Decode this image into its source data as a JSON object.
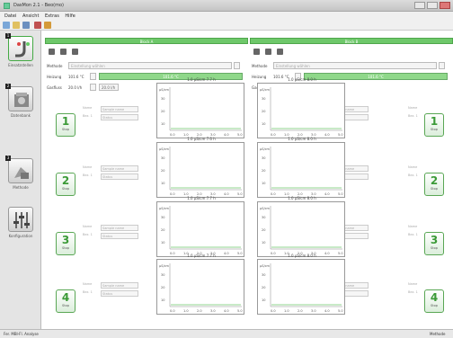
{
  "window": {
    "title": "DasMon 2.1 - Beo(mo)"
  },
  "menu": [
    "Datei",
    "Ansicht",
    "Extras",
    "Hilfe"
  ],
  "sidebar": [
    {
      "label": "Einsatzstellen",
      "num": "1"
    },
    {
      "label": "Datenbank",
      "num": "2"
    },
    {
      "label": "Methode",
      "num": "3"
    },
    {
      "label": "Konfiguration",
      "num": ""
    }
  ],
  "panels": [
    {
      "header": "Block A",
      "methode_label": "Methode",
      "methode_value": "Einstellung wählen",
      "heizung_label": "Heizung",
      "heizung_value": "101.6 °C",
      "heizung_bar": "101.6 °C",
      "heizung_percent": 100,
      "gasfluss_label": "Gasfluss",
      "gasfluss_value": "20.0 l/h",
      "gasfluss_box": "20.0 l/h"
    },
    {
      "header": "Block B",
      "methode_label": "Methode",
      "methode_value": "Einstellung wählen",
      "heizung_label": "Heizung",
      "heizung_value": "101.6 °C",
      "heizung_bar": "101.6 °C",
      "heizung_percent": 100,
      "gasfluss_label": "Gasfluss",
      "gasfluss_value": "20.0 l/h",
      "gasfluss_box": "20.0 l/h"
    }
  ],
  "channels": [
    {
      "num": "1",
      "stop": "Stop",
      "charts": [
        "1.0 µS/cm  7.7 h",
        "1.0 µS/cm  8.0 h"
      ]
    },
    {
      "num": "2",
      "stop": "Stop",
      "charts": [
        "1.0 µS/cm  7.6 h",
        "1.0 µS/cm  8.0 h"
      ]
    },
    {
      "num": "3",
      "stop": "Stop",
      "charts": [
        "1.0 µS/cm  7.7 h",
        "1.0 µS/cm  8.0 h"
      ]
    },
    {
      "num": "4",
      "stop": "Stop",
      "charts": [
        "1.0 µS/cm  7.7 h",
        "1.0 µS/cm  8.0 h"
      ]
    }
  ],
  "dropdowns": {
    "sample": "Sample name",
    "sample_lbl": "Name",
    "mode": "Status",
    "mode_lbl": "Bez. 1"
  },
  "chart_axes": {
    "y_unit": "µS/cm",
    "x_ticks": [
      "0.0",
      "1.0",
      "2.0",
      "3.0",
      "4.0",
      "5.0"
    ],
    "y_ticks": [
      "30",
      "20",
      "10"
    ]
  },
  "status": {
    "left": "Fer. MBI-Fl. Analyse",
    "right": "Methode"
  },
  "colors": {
    "accent": "#6ec86a",
    "accent_dark": "#3b9a37"
  }
}
